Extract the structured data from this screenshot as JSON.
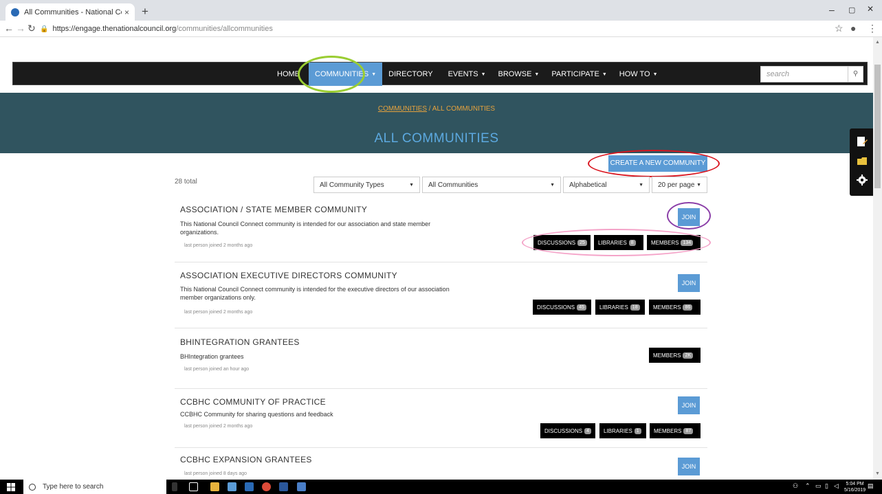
{
  "browser": {
    "tab_title": "All Communities - National Cour",
    "tab_close": "×",
    "new_tab": "+",
    "url_host": "https://engage.thenationalcouncil.org",
    "url_path": "/communities/allcommunities",
    "win_min": "–",
    "win_max": "▢",
    "win_close": "✕"
  },
  "nav": {
    "items": [
      {
        "label": "HOME",
        "caret": ""
      },
      {
        "label": "COMMUNITIES",
        "caret": "▼"
      },
      {
        "label": "DIRECTORY",
        "caret": ""
      },
      {
        "label": "EVENTS",
        "caret": "▼"
      },
      {
        "label": "BROWSE",
        "caret": "▼"
      },
      {
        "label": "PARTICIPATE",
        "caret": "▼"
      },
      {
        "label": "HOW TO",
        "caret": "▼"
      }
    ],
    "search_placeholder": "search"
  },
  "hero": {
    "crumb_link": "COMMUNITIES",
    "crumb_sep": " / ",
    "crumb_current": "ALL COMMUNITIES",
    "title": "ALL COMMUNITIES"
  },
  "toolbar": {
    "create_label": "CREATE A NEW COMMUNITY",
    "total": "28 total",
    "filters": {
      "type": "All Community Types",
      "scope": "All Communities",
      "sort": "Alphabetical",
      "per_page": "20 per page"
    }
  },
  "communities": [
    {
      "title": "ASSOCIATION / STATE MEMBER COMMUNITY",
      "desc": "This National Council Connect community is intended for our association and state member organizations.",
      "meta": "last person joined 2 months ago",
      "join": "JOIN",
      "stats": [
        {
          "label": "DISCUSSIONS",
          "count": "25"
        },
        {
          "label": "LIBRARIES",
          "count": "8"
        },
        {
          "label": "MEMBERS",
          "count": "134"
        }
      ]
    },
    {
      "title": "ASSOCIATION EXECUTIVE DIRECTORS COMMUNITY",
      "desc": "This National Council Connect community is intended for the executive directors of our association member organizations only.",
      "meta": "last person joined 2 months ago",
      "join": "JOIN",
      "stats": [
        {
          "label": "DISCUSSIONS",
          "count": "45"
        },
        {
          "label": "LIBRARIES",
          "count": "18"
        },
        {
          "label": "MEMBERS",
          "count": "86"
        }
      ]
    },
    {
      "title": "BHINTEGRATION GRANTEES",
      "desc": "BHIntegration grantees",
      "meta": "last person joined an hour ago",
      "stats": [
        {
          "label": "MEMBERS",
          "count": "2K"
        }
      ]
    },
    {
      "title": "CCBHC COMMUNITY OF PRACTICE",
      "desc": "CCBHC Community for sharing questions and feedback",
      "meta": "last person joined 2 months ago",
      "join": "JOIN",
      "stats": [
        {
          "label": "DISCUSSIONS",
          "count": "4"
        },
        {
          "label": "LIBRARIES",
          "count": "1"
        },
        {
          "label": "MEMBERS",
          "count": "87"
        }
      ]
    },
    {
      "title": "CCBHC EXPANSION GRANTEES",
      "meta": "last person joined 8 days ago",
      "join": "JOIN"
    }
  ],
  "annotations": {
    "green": "#9acd32",
    "red": "#d9141e",
    "purple": "#8b3fa8",
    "pink": "#f4a3c8"
  },
  "taskbar": {
    "search_placeholder": "Type here to search",
    "time": "5:04 PM",
    "date": "5/16/2019"
  }
}
